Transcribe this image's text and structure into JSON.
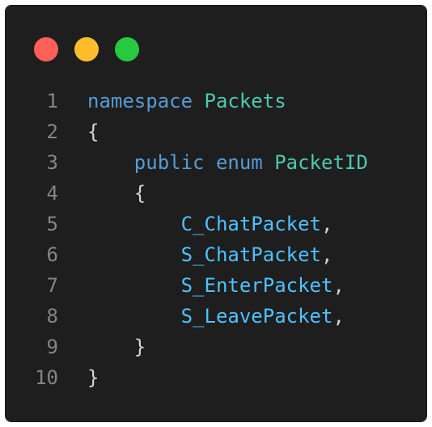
{
  "window": {
    "traffic_lights": [
      {
        "name": "close",
        "color": "#ff5f56"
      },
      {
        "name": "minimize",
        "color": "#ffbd2e"
      },
      {
        "name": "maximize",
        "color": "#27c93f"
      }
    ]
  },
  "colors": {
    "background": "#1e1e1e",
    "keyword": "#569cd6",
    "type": "#4ec9b0",
    "member": "#4fc1ff",
    "line_number": "#858585",
    "punctuation": "#d4d4d4"
  },
  "code": {
    "lines": [
      {
        "num": "1",
        "indent": "",
        "tokens": [
          {
            "t": "namespace",
            "k": "kw"
          },
          {
            "t": " ",
            "k": "punct"
          },
          {
            "t": "Packets",
            "k": "type"
          }
        ]
      },
      {
        "num": "2",
        "indent": "",
        "tokens": [
          {
            "t": "{",
            "k": "punct"
          }
        ]
      },
      {
        "num": "3",
        "indent": "    ",
        "tokens": [
          {
            "t": "public",
            "k": "kw"
          },
          {
            "t": " ",
            "k": "punct"
          },
          {
            "t": "enum",
            "k": "kw"
          },
          {
            "t": " ",
            "k": "punct"
          },
          {
            "t": "PacketID",
            "k": "type"
          }
        ]
      },
      {
        "num": "4",
        "indent": "    ",
        "tokens": [
          {
            "t": "{",
            "k": "punct"
          }
        ]
      },
      {
        "num": "5",
        "indent": "        ",
        "tokens": [
          {
            "t": "C_ChatPacket",
            "k": "member"
          },
          {
            "t": ",",
            "k": "punct"
          }
        ]
      },
      {
        "num": "6",
        "indent": "        ",
        "tokens": [
          {
            "t": "S_ChatPacket",
            "k": "member"
          },
          {
            "t": ",",
            "k": "punct"
          }
        ]
      },
      {
        "num": "7",
        "indent": "        ",
        "tokens": [
          {
            "t": "S_EnterPacket",
            "k": "member"
          },
          {
            "t": ",",
            "k": "punct"
          }
        ]
      },
      {
        "num": "8",
        "indent": "        ",
        "tokens": [
          {
            "t": "S_LeavePacket",
            "k": "member"
          },
          {
            "t": ",",
            "k": "punct"
          }
        ]
      },
      {
        "num": "9",
        "indent": "    ",
        "tokens": [
          {
            "t": "}",
            "k": "punct"
          }
        ]
      },
      {
        "num": "10",
        "indent": "",
        "tokens": [
          {
            "t": "}",
            "k": "punct"
          }
        ]
      }
    ]
  }
}
